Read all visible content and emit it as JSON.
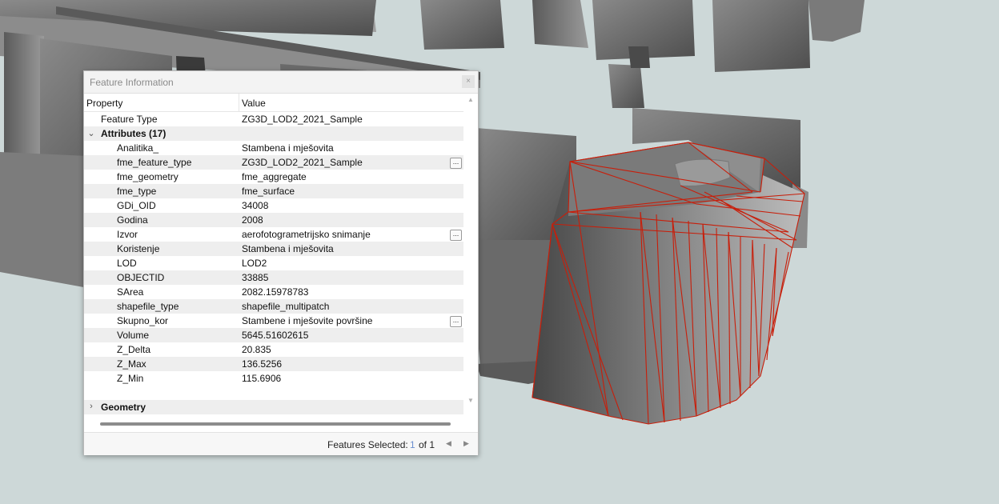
{
  "panel": {
    "title": "Feature Information",
    "close_glyph": "×",
    "columns": {
      "property": "Property",
      "value": "Value"
    },
    "feature_type": {
      "label": "Feature Type",
      "value": "ZG3D_LOD2_2021_Sample"
    },
    "attributes_group": {
      "label": "Attributes (17)",
      "expanded": true
    },
    "attributes": [
      {
        "property": "Analitika_",
        "value": "Stambena i mješovita",
        "more": false
      },
      {
        "property": "fme_feature_type",
        "value": "ZG3D_LOD2_2021_Sample",
        "more": true
      },
      {
        "property": "fme_geometry",
        "value": "fme_aggregate",
        "more": false
      },
      {
        "property": "fme_type",
        "value": "fme_surface",
        "more": false
      },
      {
        "property": "GDi_OID",
        "value": "34008",
        "more": false
      },
      {
        "property": "Godina",
        "value": "2008",
        "more": false
      },
      {
        "property": "Izvor",
        "value": "aerofotogrametrijsko snimanje",
        "more": true
      },
      {
        "property": "Koristenje",
        "value": "Stambena i mješovita",
        "more": false
      },
      {
        "property": "LOD",
        "value": "LOD2",
        "more": false
      },
      {
        "property": "OBJECTID",
        "value": "33885",
        "more": false
      },
      {
        "property": "SArea",
        "value": "2082.15978783",
        "more": false
      },
      {
        "property": "shapefile_type",
        "value": "shapefile_multipatch",
        "more": false
      },
      {
        "property": "Skupno_kor",
        "value": "Stambene i mješovite površine",
        "more": true
      },
      {
        "property": "Volume",
        "value": "5645.51602615",
        "more": false
      },
      {
        "property": "Z_Delta",
        "value": "20.835",
        "more": false
      },
      {
        "property": "Z_Max",
        "value": "136.5256",
        "more": false
      },
      {
        "property": "Z_Min",
        "value": "115.6906",
        "more": false
      }
    ],
    "geometry_group": {
      "label": "Geometry",
      "expanded": false
    },
    "more_glyph": "...",
    "footer": {
      "label": "Features Selected:",
      "current": "1",
      "of_text": "of 1"
    }
  },
  "icons": {
    "expanded": "chevron-down-icon",
    "collapsed": "chevron-right-icon",
    "prev": "triangle-left-icon",
    "next": "triangle-right-icon"
  },
  "colors": {
    "selection_outline": "#c81e0a",
    "building": "#6e6e6e",
    "ground": "#cdd8d8",
    "accent": "#6a8fd0"
  }
}
